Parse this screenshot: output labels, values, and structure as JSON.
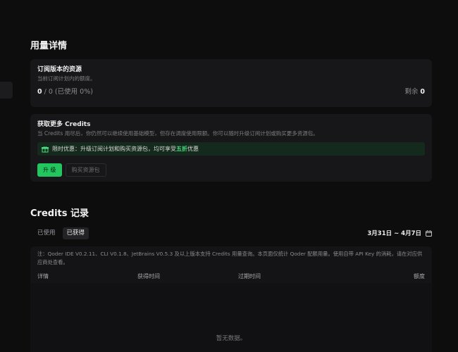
{
  "usage": {
    "title": "用量详情",
    "subscription": {
      "title": "订阅版本的资源",
      "desc": "当前订阅计划内的额度。",
      "used": "0",
      "rest": " / 0 (已使用 0%)",
      "remain_label": "剩余",
      "remain_value": "0"
    },
    "more": {
      "title": "获取更多 Credits",
      "desc": "当 Credits 用尽后，你仍然可以继续使用基础模型，但存在调度使用限额。你可以随时升级订阅计划或购买更多资源包。",
      "promo_prefix": "限时优惠：升级订阅计划和购买资源包，均可享受",
      "promo_highlight": "五折",
      "promo_suffix": "优惠",
      "upgrade_label": "升 级",
      "buy_label": "购买资源包"
    }
  },
  "credits": {
    "title": "Credits 记录",
    "tabs": [
      {
        "label": "已使用"
      },
      {
        "label": "已获得"
      }
    ],
    "date_range": "3月31日 ~ 4月7日",
    "note": "注：Qoder IDE V0.2.11、CLI V0.1.8、JetBrains V0.5.3 及以上版本支持 Credits 用量查询。本页面仅统计 Qoder 配额用量。使用自带 API Key 的消耗，请在对应供应商处查看。",
    "columns": [
      "详情",
      "获得时间",
      "过期时间",
      "额度"
    ],
    "empty_text": "暂无数据。"
  },
  "colors": {
    "accent": "#22c55e",
    "highlight": "#4ade80",
    "background": "#0d0d0e",
    "card": "#17171a"
  },
  "icons": {
    "promo": "gift-icon",
    "date": "calendar-icon"
  }
}
